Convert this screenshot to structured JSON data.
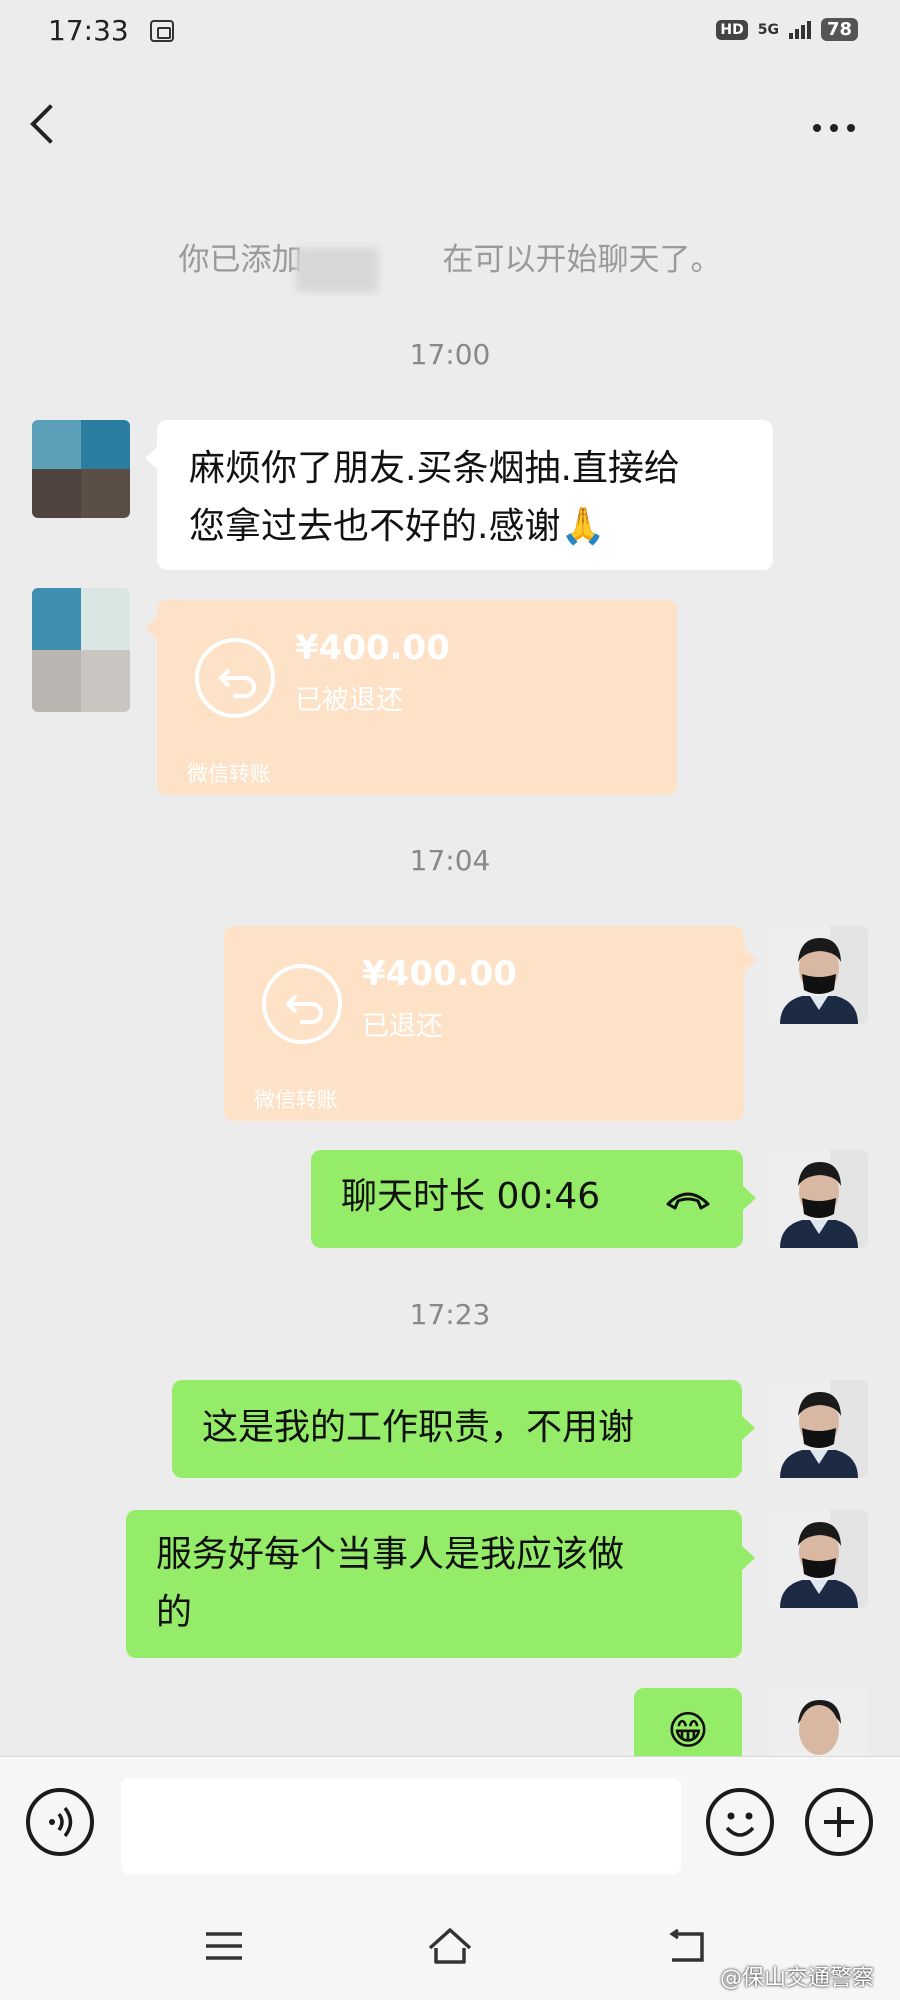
{
  "status_bar": {
    "time": "17:33",
    "hd": "HD",
    "network": "5G",
    "battery": "78"
  },
  "header": {
    "back_icon": "chevron-left-icon",
    "more_icon": "more-dots-icon"
  },
  "system": {
    "added_text_before": "你已添加",
    "added_text_after": "在可以开始聊天了。"
  },
  "messages": {
    "time_1": "17:00",
    "contact_text_line1": "麻烦你了朋友.买条烟抽.直接给",
    "contact_text_line2": "您拿过去也不好的.感谢🙏",
    "contact_transfer": {
      "amount": "¥400.00",
      "status": "已被退还",
      "footer": "微信转账"
    },
    "time_2": "17:04",
    "my_transfer": {
      "amount": "¥400.00",
      "status": "已退还",
      "footer": "微信转账"
    },
    "call": {
      "text": "聊天时长 00:46",
      "icon": "hang-up-phone-icon"
    },
    "time_3": "17:23",
    "reply_1": "这是我的工作职责，不用谢",
    "reply_2_line1": "服务好每个当事人是我应该做",
    "reply_2_line2": "的",
    "emoji": "😁"
  },
  "input_bar": {
    "voice_icon": "voice-icon",
    "emoji_icon": "smile-icon",
    "plus_icon": "plus-icon"
  },
  "nav_bar": {
    "menu_icon": "menu-icon",
    "home_icon": "home-icon",
    "back_icon": "back-arrow-icon"
  },
  "watermark": "@保山交通警察",
  "colors": {
    "background": "#ececec",
    "green_bubble": "#95ec69",
    "white_bubble": "#ffffff",
    "transfer_card": "#fde2c7"
  }
}
